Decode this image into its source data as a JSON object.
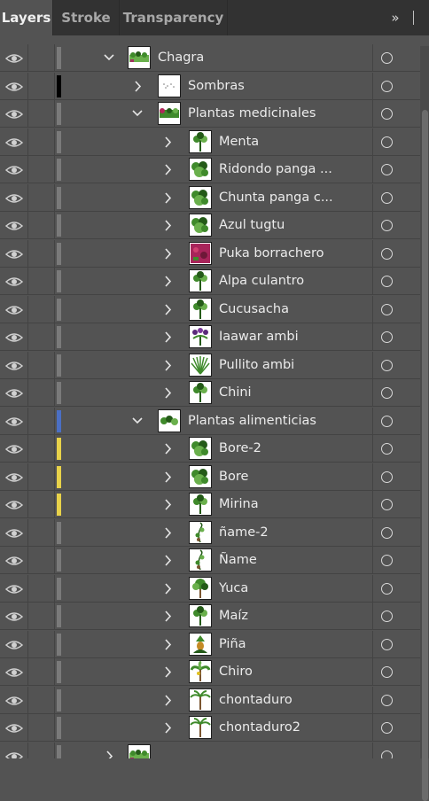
{
  "tabs": [
    {
      "label": "Layers",
      "active": true
    },
    {
      "label": "Stroke",
      "active": false
    },
    {
      "label": "Transparency",
      "active": false
    }
  ],
  "panel_more": "»",
  "colors": {
    "yellow": "#e8d24a",
    "blue": "#4b6fc4",
    "gray": "#7a7a7a",
    "black": "#000000"
  },
  "rows": [
    {
      "name": "Chagra",
      "level": 0,
      "expanded": true,
      "color": "#7a7a7a",
      "thumb": "chagra"
    },
    {
      "name": "Sombras",
      "level": 1,
      "expanded": false,
      "color": "#000000",
      "thumb": "sombras"
    },
    {
      "name": "Plantas medicinales",
      "level": 1,
      "expanded": true,
      "color": "#7a7a7a",
      "thumb": "group-red"
    },
    {
      "name": "Menta",
      "level": 2,
      "expanded": false,
      "color": "#7a7a7a",
      "thumb": "plant"
    },
    {
      "name": "Ridondo panga ...",
      "level": 2,
      "expanded": false,
      "color": "#7a7a7a",
      "thumb": "bush"
    },
    {
      "name": "Chunta panga c...",
      "level": 2,
      "expanded": false,
      "color": "#7a7a7a",
      "thumb": "bush"
    },
    {
      "name": "Azul tugtu",
      "level": 2,
      "expanded": false,
      "color": "#7a7a7a",
      "thumb": "bush"
    },
    {
      "name": "Puka borrachero",
      "level": 2,
      "expanded": false,
      "color": "#7a7a7a",
      "thumb": "red"
    },
    {
      "name": "Alpa culantro",
      "level": 2,
      "expanded": false,
      "color": "#7a7a7a",
      "thumb": "plant"
    },
    {
      "name": "Cucusacha",
      "level": 2,
      "expanded": false,
      "color": "#7a7a7a",
      "thumb": "plant"
    },
    {
      "name": "Iaawar ambi",
      "level": 2,
      "expanded": false,
      "color": "#7a7a7a",
      "thumb": "purple"
    },
    {
      "name": "Pullito ambi",
      "level": 2,
      "expanded": false,
      "color": "#7a7a7a",
      "thumb": "grass"
    },
    {
      "name": "Chini",
      "level": 2,
      "expanded": false,
      "color": "#7a7a7a",
      "thumb": "plant"
    },
    {
      "name": "Plantas alimenticias",
      "level": 1,
      "expanded": true,
      "color": "#4b6fc4",
      "thumb": "group-green"
    },
    {
      "name": "Bore-2",
      "level": 2,
      "expanded": false,
      "color": "#e8d24a",
      "thumb": "bush"
    },
    {
      "name": "Bore",
      "level": 2,
      "expanded": false,
      "color": "#e8d24a",
      "thumb": "bush"
    },
    {
      "name": "Mirina",
      "level": 2,
      "expanded": false,
      "color": "#e8d24a",
      "thumb": "plant"
    },
    {
      "name": "ñame-2",
      "level": 2,
      "expanded": false,
      "color": "#7a7a7a",
      "thumb": "vine"
    },
    {
      "name": "Ñame",
      "level": 2,
      "expanded": false,
      "color": "#7a7a7a",
      "thumb": "vine"
    },
    {
      "name": "Yuca",
      "level": 2,
      "expanded": false,
      "color": "#7a7a7a",
      "thumb": "tree"
    },
    {
      "name": "Maíz",
      "level": 2,
      "expanded": false,
      "color": "#7a7a7a",
      "thumb": "plant"
    },
    {
      "name": "Piña",
      "level": 2,
      "expanded": false,
      "color": "#7a7a7a",
      "thumb": "pine"
    },
    {
      "name": "Chiro",
      "level": 2,
      "expanded": false,
      "color": "#7a7a7a",
      "thumb": "banana"
    },
    {
      "name": "chontaduro",
      "level": 2,
      "expanded": false,
      "color": "#7a7a7a",
      "thumb": "palm"
    },
    {
      "name": "chontaduro2",
      "level": 2,
      "expanded": false,
      "color": "#7a7a7a",
      "thumb": "palm"
    },
    {
      "name": "",
      "level": 0,
      "expanded": false,
      "color": "#7a7a7a",
      "thumb": "chagra"
    }
  ]
}
